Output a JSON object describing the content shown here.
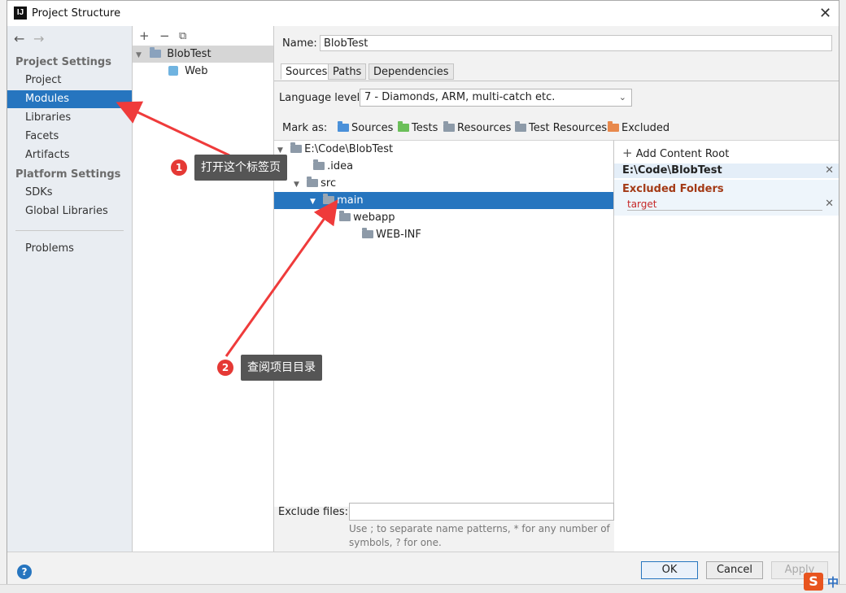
{
  "window": {
    "title": "Project Structure"
  },
  "left_panel": {
    "project_settings_title": "Project Settings",
    "project_settings": [
      "Project",
      "Modules",
      "Libraries",
      "Facets",
      "Artifacts"
    ],
    "platform_settings_title": "Platform Settings",
    "platform_settings": [
      "SDKs",
      "Global Libraries"
    ],
    "problems": "Problems",
    "selected": "Modules"
  },
  "module_tree": {
    "root": "BlobTest",
    "child": "Web"
  },
  "content": {
    "name_label": "Name:",
    "name_value": "BlobTest",
    "tabs": [
      "Sources",
      "Paths",
      "Dependencies"
    ],
    "active_tab": "Sources",
    "language_level_label": "Language level:",
    "language_level_value": "7 - Diamonds, ARM, multi-catch etc.",
    "mark_as_label": "Mark as:",
    "mark_as": [
      {
        "label": "Sources",
        "color": "#4a90d9"
      },
      {
        "label": "Tests",
        "color": "#6bbf59"
      },
      {
        "label": "Resources",
        "color": "#8d9aa8"
      },
      {
        "label": "Test Resources",
        "color": "#8d9aa8"
      },
      {
        "label": "Excluded",
        "color": "#e8894c"
      }
    ],
    "tree": {
      "root": "E:\\Code\\BlobTest",
      "idea": ".idea",
      "src": "src",
      "main": "main",
      "webapp": "webapp",
      "webinf": "WEB-INF"
    },
    "content_root": {
      "add_label": "Add Content Root",
      "path": "E:\\Code\\BlobTest",
      "excluded_title": "Excluded Folders",
      "excluded_item": "target"
    },
    "exclude_files_label": "Exclude files:",
    "exclude_files_hint": "Use ; to separate name patterns, * for any number of symbols, ? for one."
  },
  "buttons": {
    "ok": "OK",
    "cancel": "Cancel",
    "apply": "Apply"
  },
  "annotations": [
    {
      "number": "1",
      "text": "打开这个标签页"
    },
    {
      "number": "2",
      "text": "查阅项目目录"
    }
  ],
  "ime": {
    "logo": "S",
    "mode": "中"
  }
}
